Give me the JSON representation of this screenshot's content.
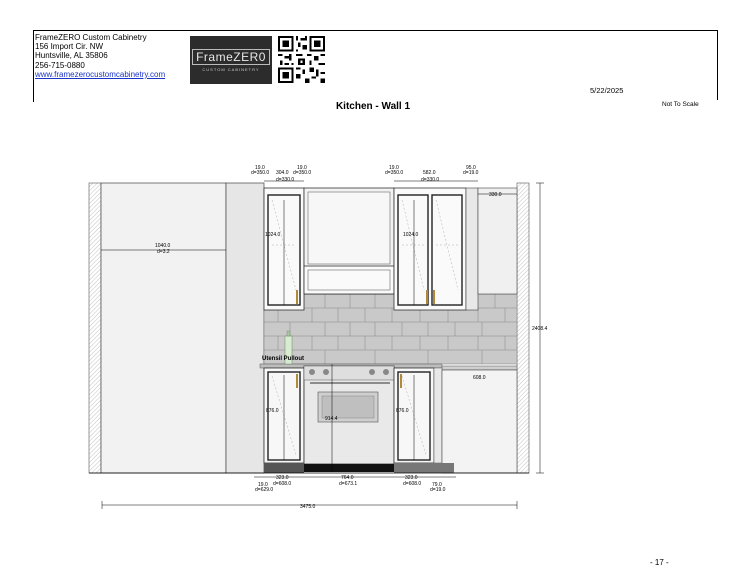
{
  "header": {
    "company_name": "FrameZERO Custom Cabinetry",
    "address_line1": "156 Import Cir. NW",
    "address_line2": "Huntsville, AL 35806",
    "phone": "256-715-0880",
    "website": "www.framezerocustomcabinetry.com",
    "logo_text": "FrameZER0",
    "logo_subtext": "CUSTOM CABINETRY",
    "date": "5/22/2025",
    "scale_note": "Not To Scale"
  },
  "title": "Kitchen  -  Wall 1",
  "page_number": "- 17 -",
  "drawing": {
    "callout_label": "Utensil Pullout",
    "dims": {
      "left_panel_w": "1040.0",
      "left_panel_d": "d=3.2",
      "left_upper_gap1": "19.0",
      "left_upper_gap1_d": "d=350.0",
      "left_upper_w": "304.0",
      "left_upper_d": "d=330.0",
      "left_upper_gap2": "19.0",
      "left_upper_gap2_d": "d=350.0",
      "left_upper_h": "1024.0",
      "right_upper_gap1": "19.0",
      "right_upper_gap1_d": "d=350.0",
      "right_upper_w": "582.0",
      "right_upper_d": "d=330.0",
      "right_upper_gap2": "95.0",
      "right_upper_gap2_d": "d=19.0",
      "right_upper_h": "1024.0",
      "right_top_w": "330.0",
      "overall_h": "2408.4",
      "right_base_w": "608.0",
      "left_base_h": "876.0",
      "right_base_h": "876.0",
      "range_h": "914.4",
      "base_gap_l": "19.0",
      "base_gap_l_d": "d=629.0",
      "left_base_w": "323.0",
      "left_base_d": "d=608.0",
      "range_w": "764.0",
      "range_d": "d=673.1",
      "right_base_w2": "323.0",
      "right_base_d2": "d=608.0",
      "base_gap_r": "79.0",
      "base_gap_r_d": "d=19.0",
      "overall_w": "3475.0"
    }
  }
}
